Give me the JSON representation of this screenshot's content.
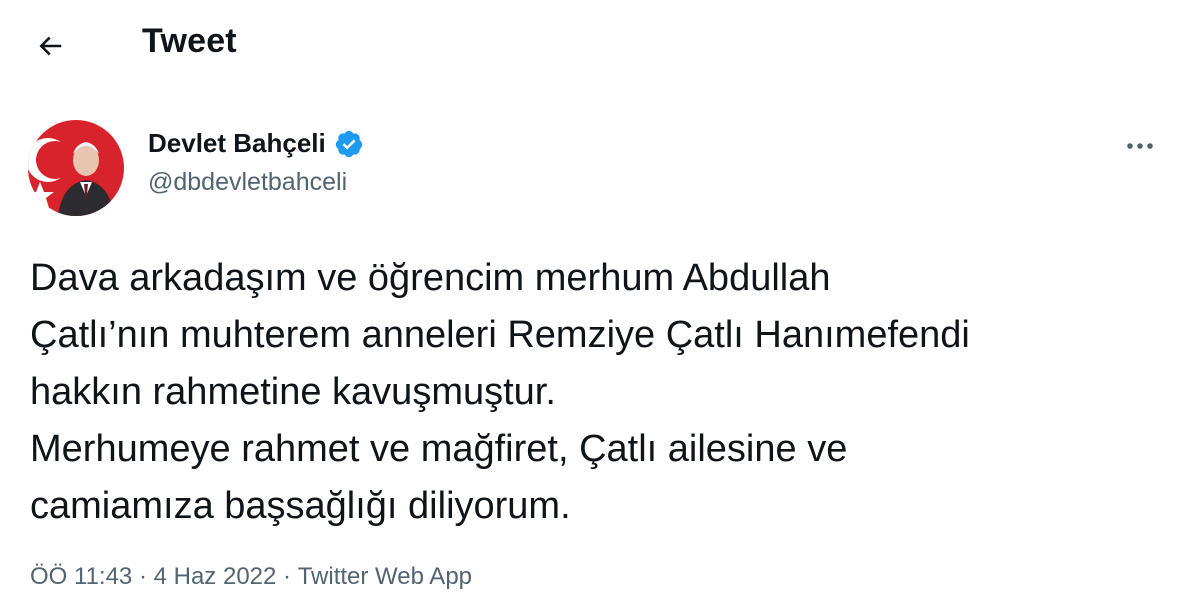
{
  "header": {
    "title": "Tweet"
  },
  "author": {
    "name": "Devlet Bahçeli",
    "handle": "@dbdevletbahceli",
    "verified": true,
    "verified_color": "#1d9bf0"
  },
  "tweet": {
    "text": "Dava arkadaşım ve öğrencim merhum Abdullah\nÇatlı’nın muhterem anneleri Remziye Çatlı Hanımefendi\nhakkın rahmetine kavuşmuştur.\nMerhumeye rahmet ve mağfiret, Çatlı ailesine ve\ncamiamıza başsağlığı diliyorum."
  },
  "meta": {
    "time": "ÖÖ 11:43",
    "separator1": " · ",
    "date": "4 Haz 2022",
    "separator2": " · ",
    "source": "Twitter Web App"
  },
  "icons": {
    "back": "arrow-left-icon",
    "more": "more-horizontal-icon",
    "verified": "verified-badge-icon"
  }
}
